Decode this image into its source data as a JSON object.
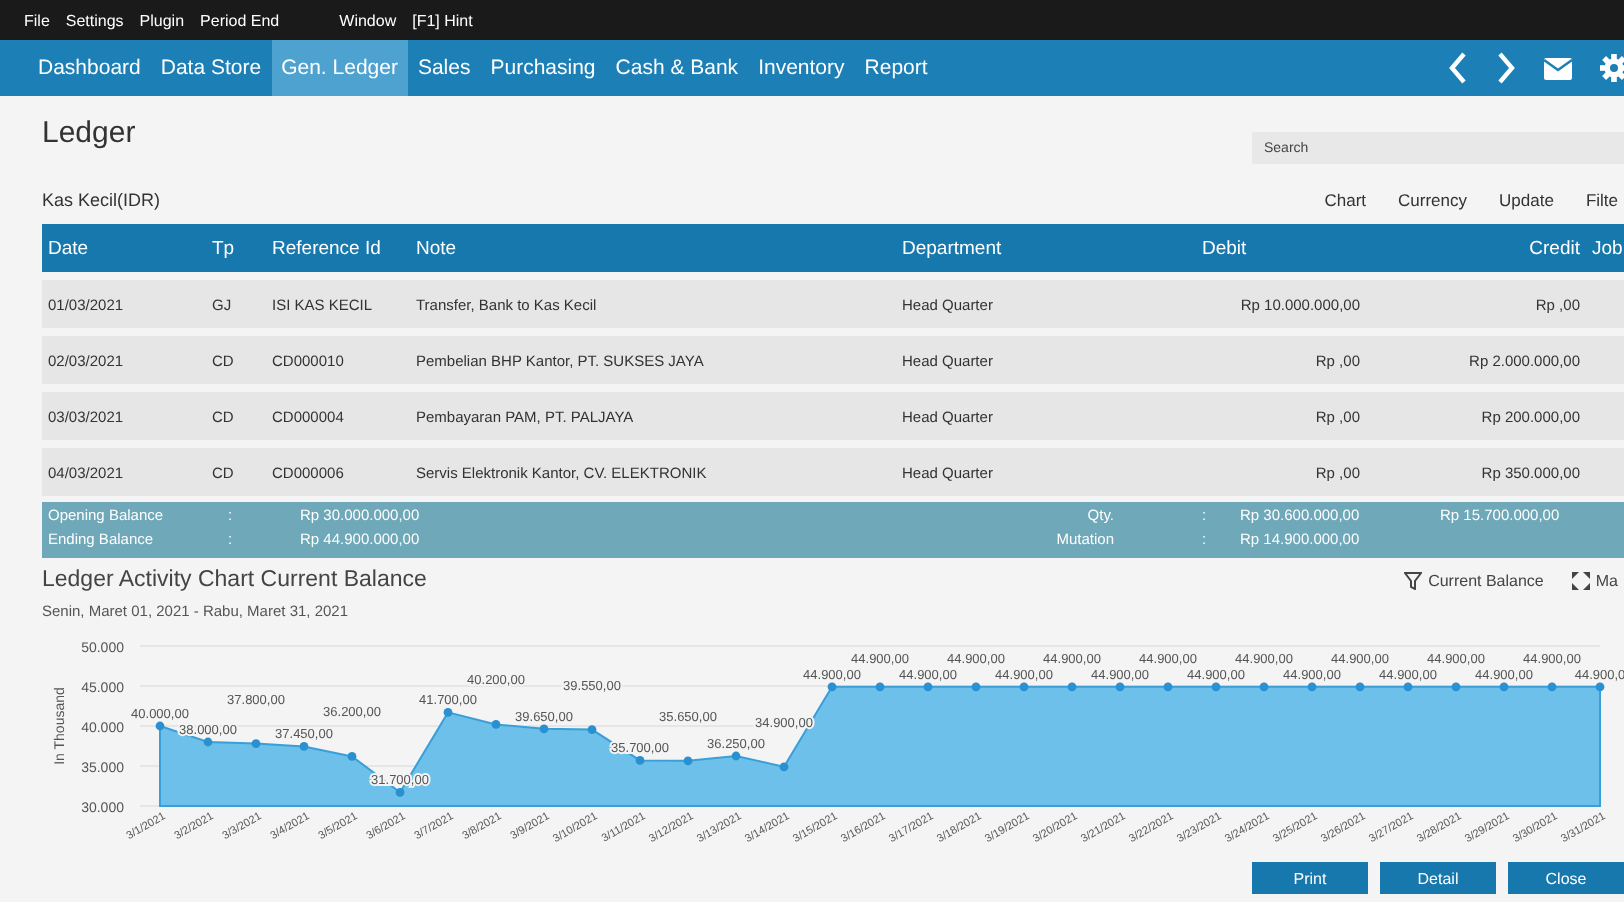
{
  "menu_bar": [
    "File",
    "Settings",
    "Plugin",
    "Period End",
    "Window",
    "[F1] Hint"
  ],
  "nav": [
    {
      "label": "Dashboard",
      "selected": false
    },
    {
      "label": "Data Store",
      "selected": false
    },
    {
      "label": "Gen. Ledger",
      "selected": true
    },
    {
      "label": "Sales",
      "selected": false
    },
    {
      "label": "Purchasing",
      "selected": false
    },
    {
      "label": "Cash & Bank",
      "selected": false
    },
    {
      "label": "Inventory",
      "selected": false
    },
    {
      "label": "Report",
      "selected": false
    }
  ],
  "page_title": "Ledger",
  "search": {
    "placeholder": "Search"
  },
  "account": "Kas Kecil(IDR)",
  "actions": [
    "Chart",
    "Currency",
    "Update",
    "Filte"
  ],
  "table": {
    "columns": [
      "Date",
      "Tp",
      "Reference Id",
      "Note",
      "Department",
      "Debit",
      "Credit",
      "Job"
    ],
    "rows": [
      [
        "01/03/2021",
        "GJ",
        "ISI KAS KECIL",
        "Transfer, Bank to Kas Kecil",
        "Head Quarter",
        "Rp 10.000.000,00",
        "Rp ,00"
      ],
      [
        "02/03/2021",
        "CD",
        "CD000010",
        "Pembelian BHP Kantor, PT. SUKSES JAYA",
        "Head Quarter",
        "Rp ,00",
        "Rp 2.000.000,00"
      ],
      [
        "03/03/2021",
        "CD",
        "CD000004",
        "Pembayaran PAM, PT. PALJAYA",
        "Head Quarter",
        "Rp ,00",
        "Rp 200.000,00"
      ],
      [
        "04/03/2021",
        "CD",
        "CD000006",
        "Servis Elektronik Kantor, CV. ELEKTRONIK",
        "Head Quarter",
        "Rp ,00",
        "Rp 350.000,00"
      ]
    ]
  },
  "summary": {
    "opening_label": "Opening Balance",
    "opening_sep": ":",
    "opening_value": "Rp 30.000.000,00",
    "ending_label": "Ending Balance",
    "ending_sep": ":",
    "ending_value": "Rp 44.900.000,00",
    "qty_label": "Qty.",
    "qty_sep": ":",
    "qty_debit": "Rp 30.600.000,00",
    "qty_credit": "Rp 15.700.000,00",
    "mutation_label": "Mutation",
    "mutation_sep": ":",
    "mutation_value": "Rp 14.900.000,00"
  },
  "chart_section": {
    "subtitle": "Senin, Maret 01, 2021 - Rabu, Maret 31, 2021",
    "filter_button": "Current Balance",
    "maximize_button": "Ma",
    "chart_data": {
      "type": "area",
      "grid": true,
      "title": "Ledger Activity Chart Current Balance",
      "ylabel": "In Thousand",
      "ylim": [
        30000,
        50000
      ],
      "yticks": [
        {
          "value": 30000,
          "label": "30.000"
        },
        {
          "value": 35000,
          "label": "35.000"
        },
        {
          "value": 40000,
          "label": "40.000"
        },
        {
          "value": 45000,
          "label": "45.000"
        },
        {
          "value": 50000,
          "label": "50.000"
        }
      ],
      "categories": [
        "3/1/2021",
        "3/2/2021",
        "3/3/2021",
        "3/4/2021",
        "3/5/2021",
        "3/6/2021",
        "3/7/2021",
        "3/8/2021",
        "3/9/2021",
        "3/10/2021",
        "3/11/2021",
        "3/12/2021",
        "3/13/2021",
        "3/14/2021",
        "3/15/2021",
        "3/16/2021",
        "3/17/2021",
        "3/18/2021",
        "3/19/2021",
        "3/20/2021",
        "3/21/2021",
        "3/22/2021",
        "3/23/2021",
        "3/24/2021",
        "3/25/2021",
        "3/26/2021",
        "3/27/2021",
        "3/28/2021",
        "3/29/2021",
        "3/30/2021",
        "3/31/2021"
      ],
      "series": [
        {
          "color": "#6cc0ea",
          "values": [
            40000,
            38000,
            37800,
            37450,
            36200,
            31700,
            41700,
            40200,
            39650,
            39550,
            35700,
            35650,
            36250,
            34900,
            44900,
            44900,
            44900,
            44900,
            44900,
            44900,
            44900,
            44900,
            44900,
            44900,
            44900,
            44900,
            44900,
            44900,
            44900,
            44900,
            44900
          ]
        }
      ],
      "value_labels": [
        "40.000,00",
        "38.000,00",
        "37.800,00",
        "37.450,00",
        "36.200,00",
        "31.700,00",
        "41.700,00",
        "40.200,00",
        "39.650,00",
        "39.550,00",
        "35.700,00",
        "35.650,00",
        "36.250,00",
        "34.900,00",
        "44.900,00",
        "44.900,00",
        "44.900,00",
        "44.900,00",
        "44.900,00",
        "44.900,00",
        "44.900,00",
        "44.900,00",
        "44.900,00",
        "44.900,00",
        "44.900,00",
        "44.900,00",
        "44.900,00",
        "44.900,00",
        "44.900,00",
        "44.900,00",
        "44.900,0"
      ]
    }
  },
  "buttons": [
    "Print",
    "Detail",
    "Close"
  ]
}
